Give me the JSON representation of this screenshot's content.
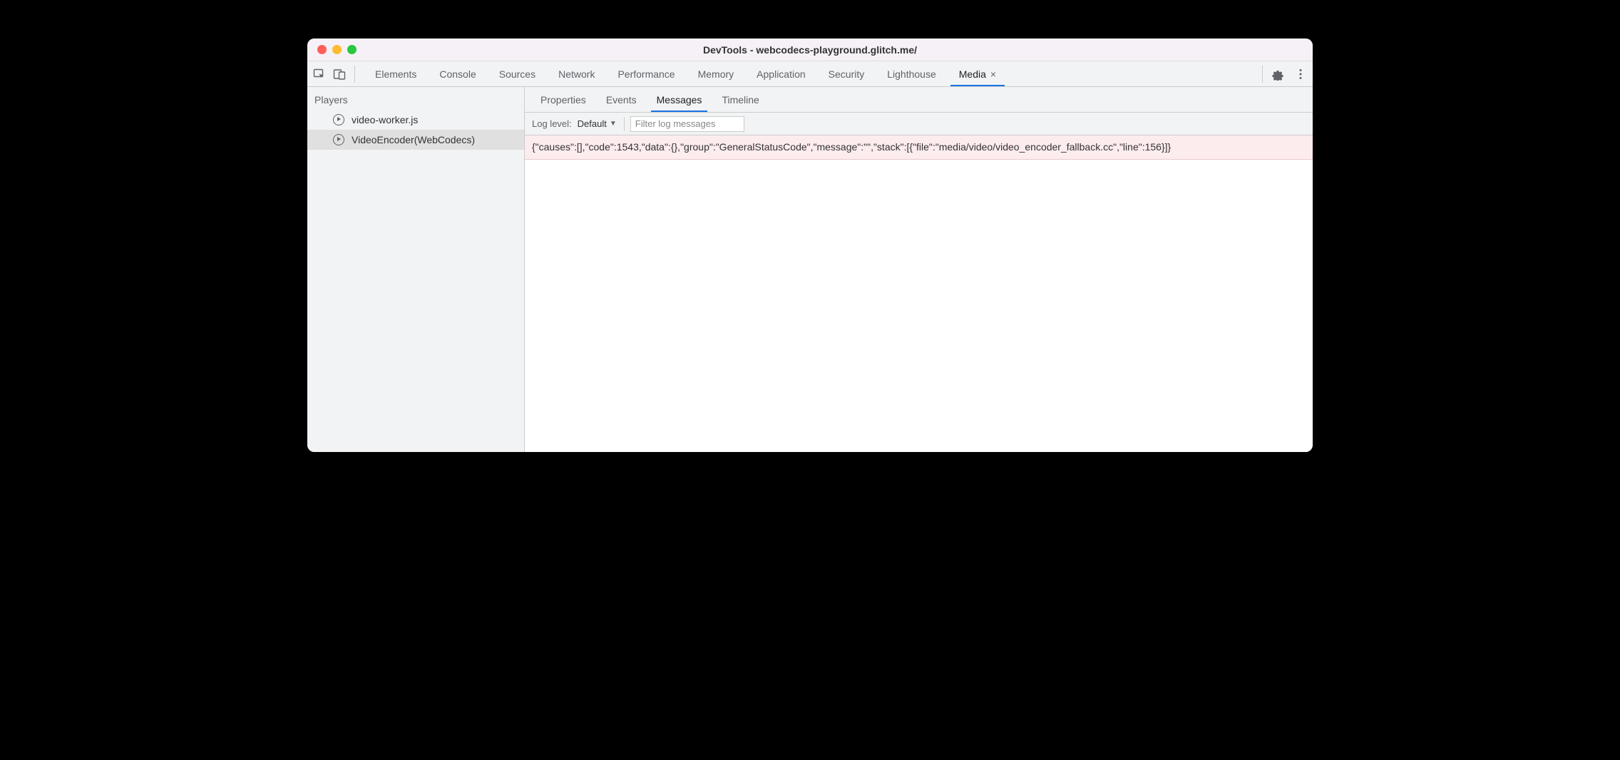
{
  "window": {
    "title": "DevTools - webcodecs-playground.glitch.me/"
  },
  "main_tabs": [
    {
      "label": "Elements",
      "active": false,
      "closable": false
    },
    {
      "label": "Console",
      "active": false,
      "closable": false
    },
    {
      "label": "Sources",
      "active": false,
      "closable": false
    },
    {
      "label": "Network",
      "active": false,
      "closable": false
    },
    {
      "label": "Performance",
      "active": false,
      "closable": false
    },
    {
      "label": "Memory",
      "active": false,
      "closable": false
    },
    {
      "label": "Application",
      "active": false,
      "closable": false
    },
    {
      "label": "Security",
      "active": false,
      "closable": false
    },
    {
      "label": "Lighthouse",
      "active": false,
      "closable": false
    },
    {
      "label": "Media",
      "active": true,
      "closable": true
    }
  ],
  "sidebar": {
    "title": "Players",
    "items": [
      {
        "label": "video-worker.js",
        "selected": false
      },
      {
        "label": "VideoEncoder(WebCodecs)",
        "selected": true
      }
    ]
  },
  "subtabs": [
    {
      "label": "Properties",
      "active": false
    },
    {
      "label": "Events",
      "active": false
    },
    {
      "label": "Messages",
      "active": true
    },
    {
      "label": "Timeline",
      "active": false
    }
  ],
  "filterbar": {
    "loglevel_label": "Log level:",
    "loglevel_value": "Default",
    "filter_placeholder": "Filter log messages"
  },
  "messages": [
    {
      "text": "{\"causes\":[],\"code\":1543,\"data\":{},\"group\":\"GeneralStatusCode\",\"message\":\"\",\"stack\":[{\"file\":\"media/video/video_encoder_fallback.cc\",\"line\":156}]}",
      "level": "error"
    }
  ]
}
